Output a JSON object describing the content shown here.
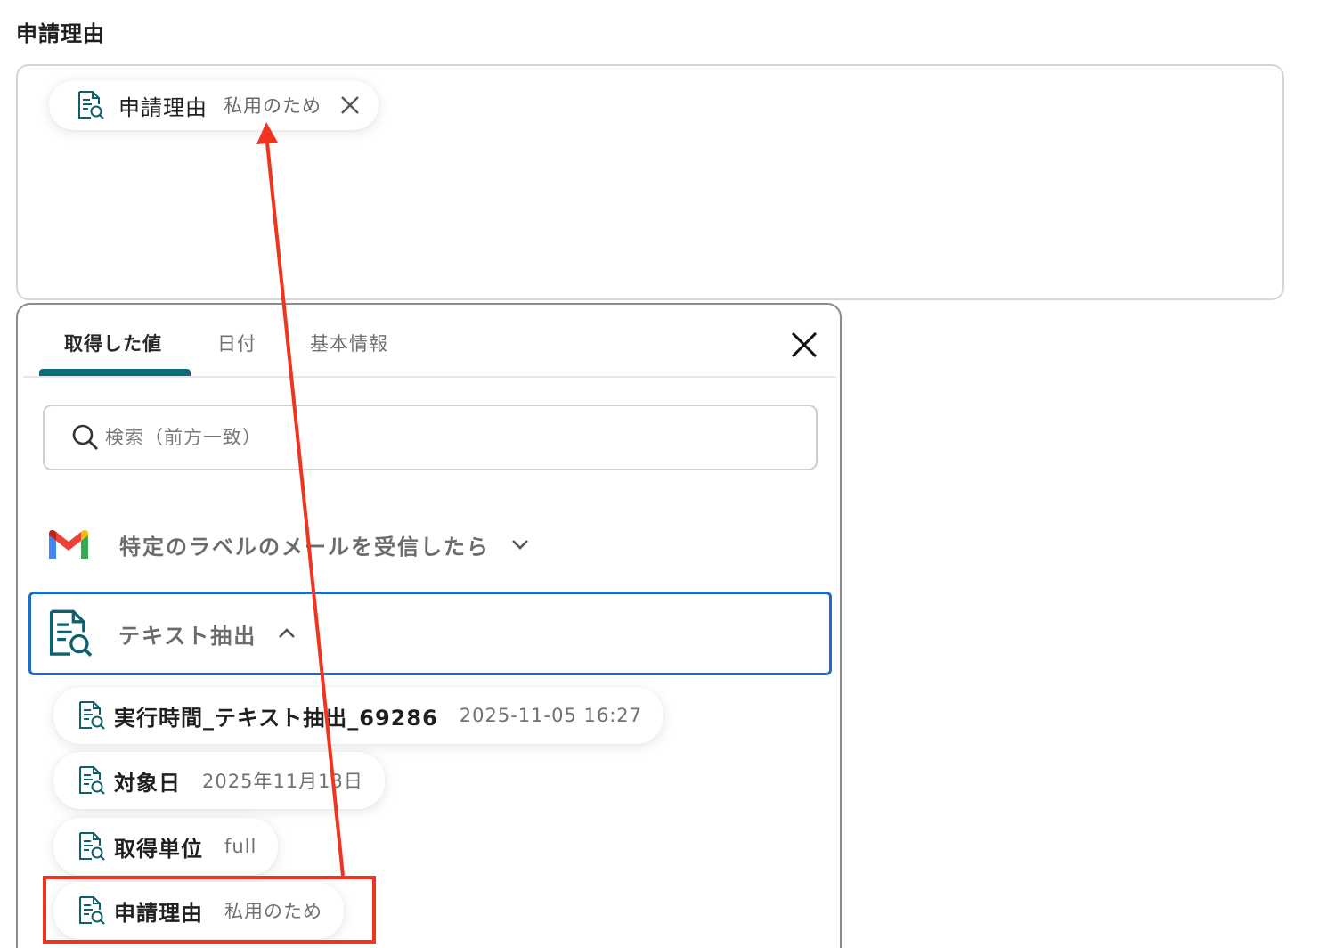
{
  "field": {
    "label": "申請理由",
    "selected_chip": {
      "label": "申請理由",
      "value": "私用のため"
    }
  },
  "panel": {
    "tabs": [
      {
        "label": "取得した値",
        "active": true
      },
      {
        "label": "日付",
        "active": false
      },
      {
        "label": "基本情報",
        "active": false
      }
    ],
    "search": {
      "placeholder": "検索（前方一致）",
      "value": ""
    },
    "sections": [
      {
        "title": "特定のラベルのメールを受信したら",
        "icon": "gmail-icon",
        "expanded": false
      },
      {
        "title": "テキスト抽出",
        "icon": "text-extract-icon",
        "expanded": true
      }
    ],
    "items": [
      {
        "label": "実行時間_テキスト抽出_69286",
        "value": "2025-11-05 16:27"
      },
      {
        "label": "対象日",
        "value": "2025年11月13日"
      },
      {
        "label": "取得単位",
        "value": "full"
      },
      {
        "label": "申請理由",
        "value": "私用のため"
      }
    ]
  },
  "colors": {
    "tab_accent": "#0a6b7a",
    "section_border": "#1e6cc8",
    "annotation_red": "#f0341f",
    "doc_icon": "#0f5f6d"
  }
}
